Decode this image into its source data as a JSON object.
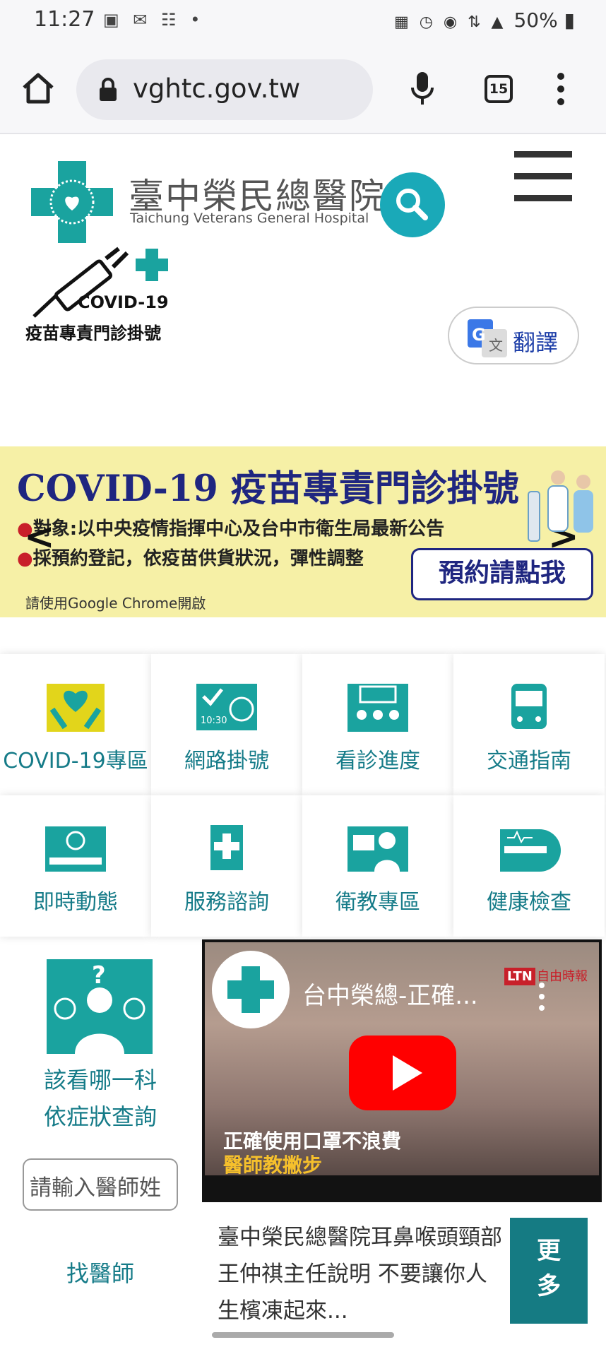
{
  "status_bar": {
    "time": "11:27",
    "battery": "50%"
  },
  "browser": {
    "url": "vghtc.gov.tw",
    "tab_count": "15"
  },
  "header": {
    "hospital_name": "臺中榮民總醫院",
    "hospital_name_en": "Taichung Veterans General Hospital",
    "vaccine_badge_title": "COVID-19",
    "vaccine_badge_sub": "疫苗專責門診掛號",
    "translate_label": "翻譯"
  },
  "banner": {
    "title": "COVID-19 疫苗專責門診掛號",
    "line1": "對象:以中央疫情指揮中心及台中市衛生局最新公告",
    "line2": "採預約登記，依疫苗供貨狀況，彈性調整",
    "note": "請使用Google Chrome開啟",
    "cta": "預約請點我",
    "prev": "<",
    "next": ">"
  },
  "tiles": [
    {
      "label": "COVID-19專區",
      "icon": "hands-heart-icon"
    },
    {
      "label": "網路掛號",
      "icon": "online-register-icon"
    },
    {
      "label": "看診進度",
      "icon": "queue-board-icon"
    },
    {
      "label": "交通指南",
      "icon": "bus-icon"
    },
    {
      "label": "即時動態",
      "icon": "question-bed-icon"
    },
    {
      "label": "服務諮詢",
      "icon": "medical-kit-icon"
    },
    {
      "label": "衛教專區",
      "icon": "nurse-icon"
    },
    {
      "label": "健康檢查",
      "icon": "scanner-icon"
    }
  ],
  "symptom": {
    "line1": "該看哪一科",
    "line2": "依症狀查詢",
    "doctor_placeholder": "請輸入醫師姓",
    "find_doctor": "找醫師"
  },
  "video": {
    "title": "台中榮總-正確...",
    "caption1": "正確使用口罩不浪費",
    "caption2": "醫師教撇步",
    "ltn": "LTN",
    "ltn_text": "自由時報"
  },
  "news": {
    "text": "臺中榮民總醫院耳鼻喉頭頸部王仲祺主任說明 不要讓你人生檳凍起來...",
    "more_1": "更",
    "more_2": "多"
  },
  "colors": {
    "teal": "#1aa39f",
    "teal_text": "#157b88",
    "banner_bg": "#f6f0a6",
    "navy": "#1f2680"
  }
}
